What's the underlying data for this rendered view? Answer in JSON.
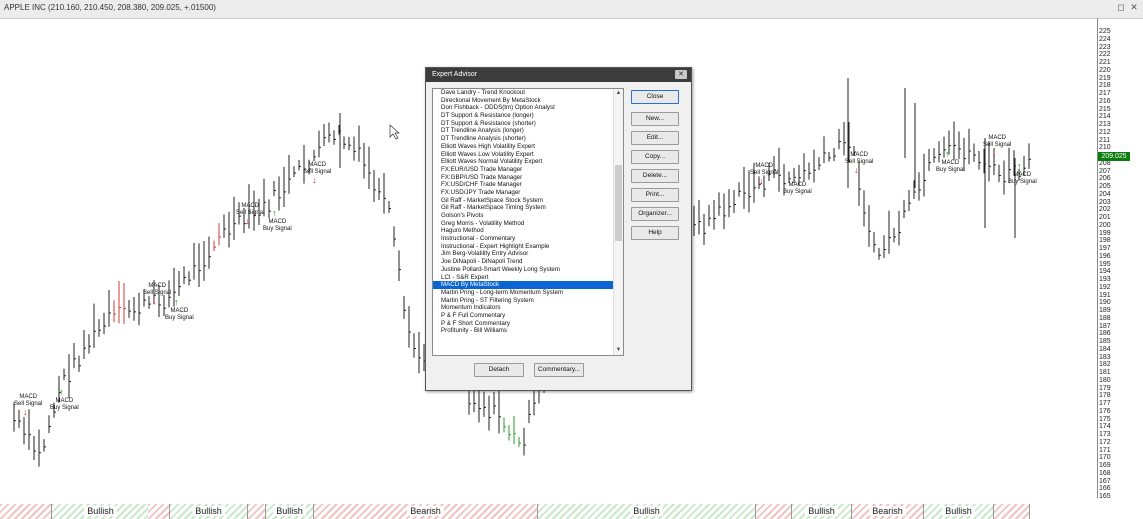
{
  "window": {
    "title": "APPLE INC (210.160, 210.450, 208.380, 209.025, +.01500)",
    "buttons": [
      "◻",
      "✕"
    ]
  },
  "price_axis": {
    "labels": [
      "225",
      "224",
      "223",
      "222",
      "221",
      "220",
      "219",
      "218",
      "217",
      "216",
      "215",
      "214",
      "213",
      "212",
      "211",
      "210",
      "209",
      "208",
      "207",
      "206",
      "205",
      "204",
      "203",
      "202",
      "201",
      "200",
      "199",
      "198",
      "197",
      "196",
      "195",
      "194",
      "193",
      "192",
      "191",
      "190",
      "189",
      "188",
      "187",
      "186",
      "185",
      "184",
      "183",
      "182",
      "181",
      "180",
      "179",
      "178",
      "177",
      "176",
      "175",
      "174",
      "173",
      "172",
      "171",
      "170",
      "169",
      "168",
      "167",
      "166",
      "165"
    ],
    "current_price": "209.025",
    "current_color": "#0a7d0a"
  },
  "signals": [
    {
      "type": "sell",
      "title": "MACD",
      "label": "Sell Signal"
    },
    {
      "type": "buy",
      "title": "MACD",
      "label": "Buy Signal"
    }
  ],
  "sentiment_bar": [
    {
      "label": "",
      "type": "bear"
    },
    {
      "label": "Bullish",
      "type": "bull"
    },
    {
      "label": "",
      "type": "bear"
    },
    {
      "label": "Bullish",
      "type": "bull"
    },
    {
      "label": "",
      "type": "bear"
    },
    {
      "label": "Bullish",
      "type": "bull"
    },
    {
      "label": "Bearish",
      "type": "bear"
    },
    {
      "label": "Bullish",
      "type": "bull"
    },
    {
      "label": "",
      "type": "bear"
    },
    {
      "label": "Bullish",
      "type": "bull"
    },
    {
      "label": "Bearish",
      "type": "bear"
    },
    {
      "label": "Bullish",
      "type": "bull"
    },
    {
      "label": "",
      "type": "bear"
    }
  ],
  "dialog": {
    "title": "Expert Advisor",
    "close_x": "✕",
    "items": [
      "Dave Landry - Trend Knockout",
      "Directional Movement By MetaStock",
      "Don Fishback - ODDS(tm) Option Analyst",
      "DT Support & Resistance (longer)",
      "DT Support & Resistance (shorter)",
      "DT Trendline Analysis (longer)",
      "DT Trendline Analysis (shorter)",
      "Elliott Waves High Volatility Expert",
      "Elliott Waves Low Volatility Expert",
      "Elliott Waves Normal Volatility Expert",
      "FX:EUR/USD Trade Manager",
      "FX:GBP/USD Trade Manager",
      "FX:USD/CHF Trade Manager",
      "FX:USD/JPY Trade Manager",
      "Gil Raff - MarketSpace Stock System",
      "Gil Raff - MarketSpace Timing System",
      "Golson's Pivots",
      "Greg Morris - Volatility Method",
      "Haguro Method",
      "Instructional - Commentary",
      "Instructional - Expert Highlight Example",
      "Jim Berg-Volatility Entry Advisor",
      "Joe DiNapoli - DiNapoli Trend",
      "Justine Pollard-Smart Weekly Long System",
      "LCI - S&R Expert",
      "MACD By MetaStock",
      "Martin Pring - Long-term Momentum System",
      "Martin Pring - ST Filtering System",
      "Momentum Indicators",
      "P & F Full Commentary",
      "P & F Short Commentary",
      "Profitunity - Bill Williams"
    ],
    "selected_index": 25,
    "side_buttons": [
      "Close",
      "New...",
      "Edit...",
      "Copy...",
      "Delete...",
      "Print...",
      "Organizer...",
      "Help"
    ],
    "bottom_buttons": [
      "Detach",
      "Commentary..."
    ]
  }
}
